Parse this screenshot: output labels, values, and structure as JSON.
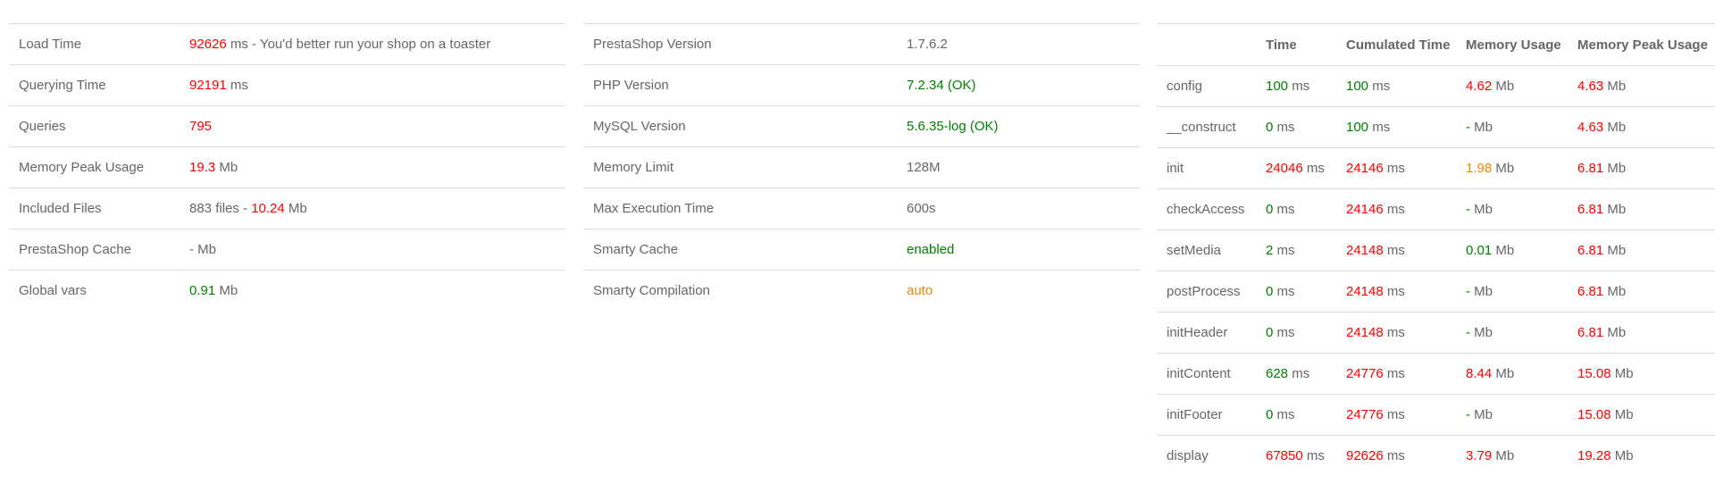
{
  "colors": {
    "danger": "#ff0000",
    "success": "#008000",
    "warning": "#ee8800",
    "text": "#666666",
    "border": "#dcdcdc"
  },
  "summary": {
    "rows": [
      {
        "label": "Load Time",
        "parts": [
          {
            "text": "92626",
            "tone": "red"
          },
          {
            "text": " ms - You'd better run your shop on a toaster",
            "tone": "grey"
          }
        ]
      },
      {
        "label": "Querying Time",
        "parts": [
          {
            "text": "92191",
            "tone": "red"
          },
          {
            "text": " ms",
            "tone": "grey"
          }
        ]
      },
      {
        "label": "Queries",
        "parts": [
          {
            "text": "795",
            "tone": "red"
          }
        ]
      },
      {
        "label": "Memory Peak Usage",
        "parts": [
          {
            "text": "19.3",
            "tone": "red"
          },
          {
            "text": " Mb",
            "tone": "grey"
          }
        ]
      },
      {
        "label": "Included Files",
        "parts": [
          {
            "text": "883 files - ",
            "tone": "grey"
          },
          {
            "text": "10.24",
            "tone": "red"
          },
          {
            "text": " Mb",
            "tone": "grey"
          }
        ]
      },
      {
        "label": "PrestaShop Cache",
        "parts": [
          {
            "text": "- Mb",
            "tone": "grey"
          }
        ]
      },
      {
        "label": "Global vars",
        "parts": [
          {
            "text": "0.91",
            "tone": "green"
          },
          {
            "text": " Mb",
            "tone": "grey"
          }
        ]
      }
    ]
  },
  "config": {
    "rows": [
      {
        "label": "PrestaShop Version",
        "value": "1.7.6.2",
        "tone": "grey"
      },
      {
        "label": "PHP Version",
        "value": "7.2.34 (OK)",
        "tone": "green"
      },
      {
        "label": "MySQL Version",
        "value": "5.6.35-log (OK)",
        "tone": "green"
      },
      {
        "label": "Memory Limit",
        "value": "128M",
        "tone": "grey"
      },
      {
        "label": "Max Execution Time",
        "value": "600s",
        "tone": "grey"
      },
      {
        "label": "Smarty Cache",
        "value": "enabled",
        "tone": "green"
      },
      {
        "label": "Smarty Compilation",
        "value": "auto",
        "tone": "orange"
      }
    ]
  },
  "controller": {
    "headers": [
      "",
      "Time",
      "Cumulated Time",
      "Memory Usage",
      "Memory Peak Usage"
    ],
    "rows": [
      {
        "name": "config",
        "time": "100",
        "time_tone": "green",
        "time_unit": " ms",
        "cumulated": "100",
        "cumulated_tone": "green",
        "cumulated_unit": " ms",
        "memory": "4.62",
        "memory_tone": "red",
        "memory_unit": " Mb",
        "peak": "4.63",
        "peak_tone": "red",
        "peak_unit": " Mb"
      },
      {
        "name": "__construct",
        "time": "0",
        "time_tone": "green",
        "time_unit": " ms",
        "cumulated": "100",
        "cumulated_tone": "green",
        "cumulated_unit": " ms",
        "memory": "-",
        "memory_tone": "green",
        "memory_unit": " Mb",
        "peak": "4.63",
        "peak_tone": "red",
        "peak_unit": " Mb"
      },
      {
        "name": "init",
        "time": "24046",
        "time_tone": "red",
        "time_unit": " ms",
        "cumulated": "24146",
        "cumulated_tone": "red",
        "cumulated_unit": " ms",
        "memory": "1.98",
        "memory_tone": "orange",
        "memory_unit": " Mb",
        "peak": "6.81",
        "peak_tone": "red",
        "peak_unit": " Mb"
      },
      {
        "name": "checkAccess",
        "time": "0",
        "time_tone": "green",
        "time_unit": " ms",
        "cumulated": "24146",
        "cumulated_tone": "red",
        "cumulated_unit": " ms",
        "memory": "-",
        "memory_tone": "green",
        "memory_unit": " Mb",
        "peak": "6.81",
        "peak_tone": "red",
        "peak_unit": " Mb"
      },
      {
        "name": "setMedia",
        "time": "2",
        "time_tone": "green",
        "time_unit": " ms",
        "cumulated": "24148",
        "cumulated_tone": "red",
        "cumulated_unit": " ms",
        "memory": "0.01",
        "memory_tone": "green",
        "memory_unit": " Mb",
        "peak": "6.81",
        "peak_tone": "red",
        "peak_unit": " Mb"
      },
      {
        "name": "postProcess",
        "time": "0",
        "time_tone": "green",
        "time_unit": " ms",
        "cumulated": "24148",
        "cumulated_tone": "red",
        "cumulated_unit": " ms",
        "memory": "-",
        "memory_tone": "green",
        "memory_unit": " Mb",
        "peak": "6.81",
        "peak_tone": "red",
        "peak_unit": " Mb"
      },
      {
        "name": "initHeader",
        "time": "0",
        "time_tone": "green",
        "time_unit": " ms",
        "cumulated": "24148",
        "cumulated_tone": "red",
        "cumulated_unit": " ms",
        "memory": "-",
        "memory_tone": "green",
        "memory_unit": " Mb",
        "peak": "6.81",
        "peak_tone": "red",
        "peak_unit": " Mb"
      },
      {
        "name": "initContent",
        "time": "628",
        "time_tone": "green",
        "time_unit": " ms",
        "cumulated": "24776",
        "cumulated_tone": "red",
        "cumulated_unit": " ms",
        "memory": "8.44",
        "memory_tone": "red",
        "memory_unit": " Mb",
        "peak": "15.08",
        "peak_tone": "red",
        "peak_unit": " Mb"
      },
      {
        "name": "initFooter",
        "time": "0",
        "time_tone": "green",
        "time_unit": " ms",
        "cumulated": "24776",
        "cumulated_tone": "red",
        "cumulated_unit": " ms",
        "memory": "-",
        "memory_tone": "green",
        "memory_unit": " Mb",
        "peak": "15.08",
        "peak_tone": "red",
        "peak_unit": " Mb"
      },
      {
        "name": "display",
        "time": "67850",
        "time_tone": "red",
        "time_unit": " ms",
        "cumulated": "92626",
        "cumulated_tone": "red",
        "cumulated_unit": " ms",
        "memory": "3.79",
        "memory_tone": "red",
        "memory_unit": " Mb",
        "peak": "19.28",
        "peak_tone": "red",
        "peak_unit": " Mb"
      }
    ]
  }
}
